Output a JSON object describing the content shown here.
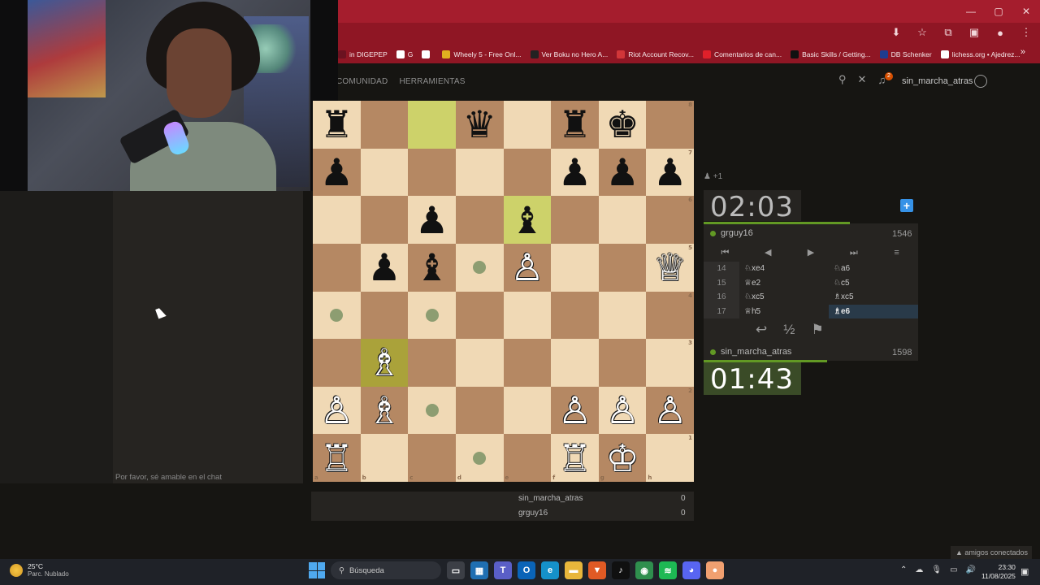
{
  "browser": {
    "window_controls": [
      "—",
      "▢",
      "✕"
    ],
    "toolbar_icons": [
      "⬇",
      "☆",
      "⧉",
      "▣",
      "●",
      "⋮"
    ],
    "bookmarks": [
      {
        "label": "in DIGEPEP",
        "color": "#6b1220"
      },
      {
        "label": "G",
        "color": "#ffffff"
      },
      {
        "label": "",
        "color": "#ffffff"
      },
      {
        "label": "Wheely 5 - Free Onl...",
        "color": "#e0b020"
      },
      {
        "label": "Ver Boku no Hero A...",
        "color": "#222222"
      },
      {
        "label": "Riot Account Recov...",
        "color": "#d13639"
      },
      {
        "label": "Comentarios de can...",
        "color": "#e0202a"
      },
      {
        "label": "Basic Skills / Getting...",
        "color": "#111111"
      },
      {
        "label": "DB Schenker",
        "color": "#1e3c90"
      },
      {
        "label": "lichess.org • Ajedrez...",
        "color": "#ffffff"
      }
    ],
    "bookmarks_more": "»"
  },
  "header": {
    "nav": [
      "COMUNIDAD",
      "HERRAMIENTAS"
    ],
    "notifications_count": "2",
    "username": "sin_marcha_atras",
    "icons": [
      "search-icon",
      "close-icon",
      "bell-icon"
    ]
  },
  "chat": {
    "placeholder": "Por favor, sé amable en el chat"
  },
  "board": {
    "ranks": [
      "8",
      "7",
      "6",
      "5",
      "4",
      "3",
      "2",
      "1"
    ],
    "files": [
      "a",
      "b",
      "c",
      "d",
      "e",
      "f",
      "g",
      "h"
    ],
    "pieces": {
      "a8": "♜",
      "d8": "♛",
      "f8": "♜",
      "g8": "♚",
      "a7": "♟",
      "f7": "♟",
      "g7": "♟",
      "h7": "♟",
      "c6": "♟",
      "e6": "♝",
      "b5": "♟",
      "c5": "♝",
      "e5": "♙",
      "h5": "♕",
      "b3": "♗",
      "a2": "♙",
      "b2": "♗",
      "f2": "♙",
      "g2": "♙",
      "h2": "♙",
      "a1": "♖",
      "f1": "♖",
      "g1": "♔"
    },
    "white_squares_pieces": [
      "e5",
      "h5",
      "b3",
      "a2",
      "b2",
      "f2",
      "g2",
      "h2",
      "a1",
      "f1",
      "g1"
    ],
    "last_move_squares": [
      "c8",
      "e6"
    ],
    "selected_square": "b3",
    "move_dots": [
      "d5",
      "a4",
      "c4",
      "c2",
      "d1"
    ]
  },
  "game": {
    "spectators": "+1",
    "top_clock": "02:03",
    "top_player": "grguy16",
    "top_rating": "1546",
    "bottom_player": "sin_marcha_atras",
    "bottom_rating": "1598",
    "bottom_clock": "01:43",
    "nav_buttons": [
      "⏮",
      "◀",
      "▶",
      "⏭",
      "≡"
    ],
    "moves": [
      {
        "n": "14",
        "w": "♘xe4",
        "b": "♘a6"
      },
      {
        "n": "15",
        "w": "♕e2",
        "b": "♘c5"
      },
      {
        "n": "16",
        "w": "♘xc5",
        "b": "♗xc5"
      },
      {
        "n": "17",
        "w": "♕h5",
        "b": "♗e6"
      }
    ],
    "current_move": "17b",
    "actions": [
      "↩",
      "½",
      "⚑"
    ]
  },
  "crosstable": {
    "rows": [
      {
        "name": "sin_marcha_atras",
        "score": "0"
      },
      {
        "name": "grguy16",
        "score": "0"
      }
    ]
  },
  "friends": "▲ amigos conectados",
  "taskbar": {
    "temp": "25°C",
    "weather": "Parc. Nublado",
    "search": "Búsqueda",
    "time": "23:30",
    "date": "11/08/2025",
    "apps": [
      {
        "name": "files-icon",
        "color": "#3c3f46",
        "glyph": "▭"
      },
      {
        "name": "store-icon",
        "color": "#1f6fb2",
        "glyph": "▦"
      },
      {
        "name": "teams-icon",
        "color": "#5a5fc7",
        "glyph": "T"
      },
      {
        "name": "outlook-icon",
        "color": "#0a64b8",
        "glyph": "O"
      },
      {
        "name": "edge-icon",
        "color": "#1591c9",
        "glyph": "e"
      },
      {
        "name": "folder-icon",
        "color": "#e8b63b",
        "glyph": "▬"
      },
      {
        "name": "brave-icon",
        "color": "#e05a24",
        "glyph": "▼"
      },
      {
        "name": "tiktok-icon",
        "color": "#101010",
        "glyph": "♪"
      },
      {
        "name": "chrome-icon",
        "color": "#2f8f4e",
        "glyph": "◉"
      },
      {
        "name": "spotify-icon",
        "color": "#1db954",
        "glyph": "≋"
      },
      {
        "name": "discord-icon",
        "color": "#5865f2",
        "glyph": "◕"
      },
      {
        "name": "app-icon",
        "color": "#f0a070",
        "glyph": "●"
      }
    ]
  }
}
